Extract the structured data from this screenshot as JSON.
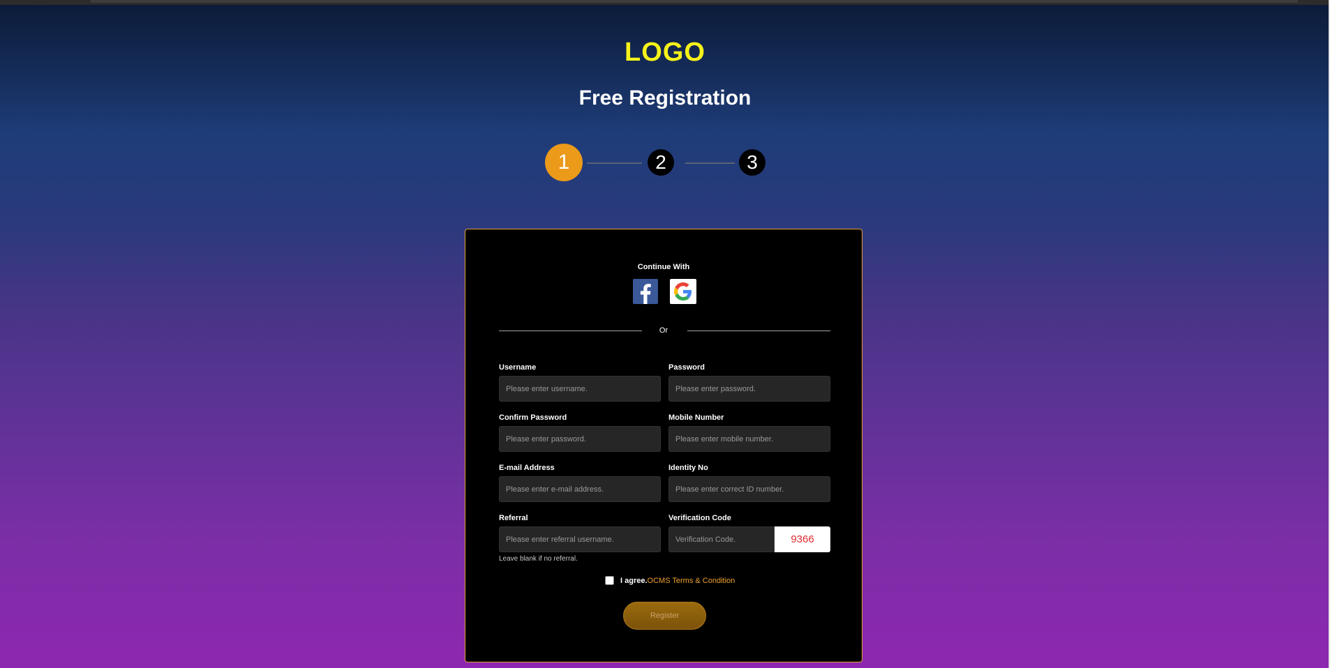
{
  "header": {
    "logo": "LOGO",
    "title": "Free Registration"
  },
  "steps": [
    {
      "label": "1",
      "state": "active",
      "color": "#eb9a1a"
    },
    {
      "label": "2",
      "state": "idle"
    },
    {
      "label": "3",
      "state": "idle"
    }
  ],
  "social": {
    "heading": "Continue With",
    "providers": [
      {
        "name": "facebook",
        "icon": "facebook-icon"
      },
      {
        "name": "google",
        "icon": "google-icon"
      }
    ],
    "divider_text": "Or"
  },
  "form": {
    "username": {
      "label": "Username",
      "placeholder": "Please enter username."
    },
    "password": {
      "label": "Password",
      "placeholder": "Please enter password."
    },
    "confirm_password": {
      "label": "Confirm Password",
      "placeholder": "Please enter password."
    },
    "mobile": {
      "label": "Mobile Number",
      "placeholder": "Please enter mobile number."
    },
    "email": {
      "label": "E-mail Address",
      "placeholder": "Please enter e-mail address."
    },
    "identity": {
      "label": "Identity No",
      "placeholder": "Please enter correct ID number."
    },
    "referral": {
      "label": "Referral",
      "placeholder": "Please enter referral username.",
      "hint": "Leave blank if no referral."
    },
    "verification": {
      "label": "Verification Code",
      "placeholder": "Verification Code.",
      "captcha": "9366"
    },
    "agree": {
      "prefix": "I agree.",
      "terms_link": "OCMS Terms & Condition",
      "checked": false
    },
    "register_label": "Register"
  },
  "colors": {
    "accent": "#eb9a1a",
    "logo": "#f5f21a",
    "card_border": "#e3a03a",
    "captcha_text": "#e0282e"
  }
}
